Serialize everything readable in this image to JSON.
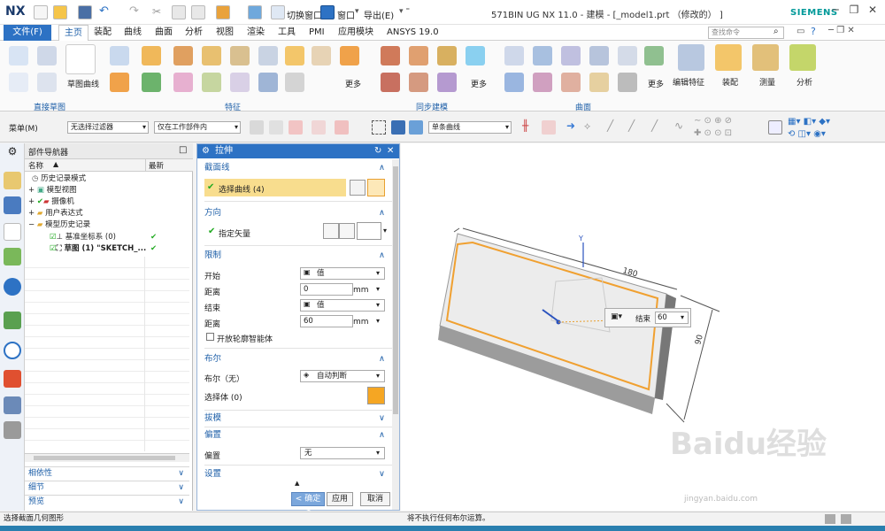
{
  "titlebar": {
    "logo": "NX",
    "switch_window": "切换窗口",
    "window_menu": "窗口",
    "export": "导出(E)",
    "title": "571BIN UG NX 11.0 - 建模 - [_model1.prt （修改的） ]",
    "brand": "SIEMENS"
  },
  "menubar": {
    "file": "文件(F)",
    "tabs": [
      "主页",
      "装配",
      "曲线",
      "曲面",
      "分析",
      "视图",
      "渲染",
      "工具",
      "PMI",
      "应用模块",
      "ANSYS 19.0"
    ],
    "search_placeholder": "查找命令"
  },
  "ribbon": {
    "sketch_label": "草图曲线",
    "group_direct_sketch": "直接草图",
    "group_feature": "特征",
    "group_sync": "同步建模",
    "group_surface": "曲面",
    "more": "更多",
    "edit_feature": "编辑特征",
    "assembly": "装配",
    "measure": "测量",
    "analysis": "分析"
  },
  "toolbar2": {
    "menu": "菜单(M)",
    "filter": "无选择过滤器",
    "scope": "仅在工作部件内",
    "curve_rule": "单条曲线"
  },
  "part_navigator": {
    "title": "部件导航器",
    "col_name": "名称",
    "col_latest": "最新",
    "items": [
      {
        "label": "历史记录模式"
      },
      {
        "label": "模型视图"
      },
      {
        "label": "摄像机"
      },
      {
        "label": "用户表达式"
      },
      {
        "label": "模型历史记录"
      },
      {
        "label": "基准坐标系 (0)"
      },
      {
        "label": "草图 (1) \"SKETCH_..."
      }
    ],
    "panels": [
      "相依性",
      "细节",
      "预览"
    ]
  },
  "extrude_dialog": {
    "title": "拉伸",
    "sec_section": "截面线",
    "select_curve": "选择曲线 (4)",
    "sec_direction": "方向",
    "specify_vector": "指定矢量",
    "sec_limits": "限制",
    "start_label": "开始",
    "start_value": "值",
    "dist1_label": "距离",
    "dist1_value": "0",
    "unit1": "mm",
    "end_label": "结束",
    "end_value": "值",
    "dist2_label": "距离",
    "dist2_value": "60",
    "unit2": "mm",
    "open_profile": "开放轮廓智能体",
    "sec_boolean": "布尔",
    "boolean_label": "布尔（无）",
    "boolean_value": "自动判断",
    "select_body": "选择体 (0)",
    "sec_draft": "拔模",
    "sec_offset": "偏置",
    "offset_label": "偏置",
    "offset_value": "无",
    "sec_settings": "设置",
    "ok": "< 确定 >",
    "apply": "应用",
    "cancel": "取消"
  },
  "viewport": {
    "dim_top": "180",
    "dim_right": "90",
    "axis_y": "Y",
    "end_label": "结束",
    "end_value": "60"
  },
  "status": {
    "left": "选择截面几何图形",
    "center": "将不执行任何布尔运算。"
  },
  "watermark": {
    "logo": "Baidu经验",
    "url": "jingyan.baidu.com"
  }
}
